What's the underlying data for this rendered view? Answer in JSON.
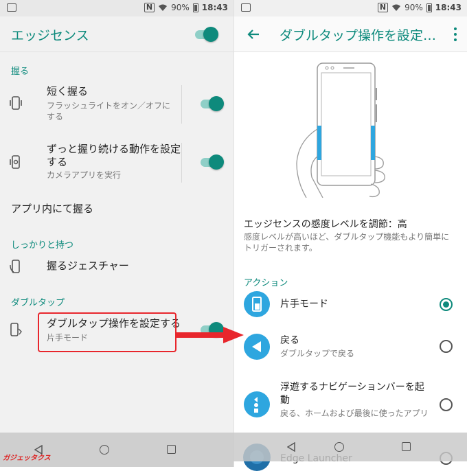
{
  "status_bar": {
    "battery": "90%",
    "time": "18:43",
    "nfc": "N"
  },
  "left": {
    "title": "エッジセンス",
    "master_toggle_on": true,
    "sections": [
      {
        "header": "握る"
      },
      {
        "header": "しっかりと持つ"
      },
      {
        "header": "ダブルタップ"
      }
    ],
    "items": {
      "short_squeeze": {
        "title": "短く握る",
        "subtitle": "フラッシュライトをオン／オフにする",
        "icon": "phone-squeeze-icon",
        "toggle_on": true
      },
      "long_squeeze": {
        "title": "ずっと握り続ける動作を設定する",
        "subtitle": "カメラアプリを実行",
        "icon": "phone-camera-icon",
        "toggle_on": true
      },
      "in_app_squeeze": {
        "title": "アプリ内にて握る"
      },
      "squeeze_gesture": {
        "title": "握るジェスチャー",
        "icon": "phone-hold-icon"
      },
      "double_tap": {
        "title": "ダブルタップ操作を設定する",
        "subtitle": "片手モード",
        "icon": "phone-doubletap-icon",
        "toggle_on": true
      }
    }
  },
  "right": {
    "title": "ダブルタップ操作を設定…",
    "sensitivity_title": "エッジセンスの感度レベルを調節：高",
    "sensitivity_desc": "感度レベルが高いほど、ダブルタップ機能もより簡単にトリガーされます。",
    "actions_header": "アクション",
    "actions": [
      {
        "title": "片手モード",
        "subtitle": "",
        "icon": "one-hand-mode-icon",
        "selected": true
      },
      {
        "title": "戻る",
        "subtitle": "ダブルタップで戻る",
        "icon": "back-triangle-icon",
        "selected": false
      },
      {
        "title": "浮遊するナビゲーションバーを起動",
        "subtitle": "戻る、ホームおよび最後に使ったアプリ",
        "icon": "floating-navbar-icon",
        "selected": false
      },
      {
        "title": "Edge Launcher",
        "subtitle": "",
        "icon": "edge-launcher-icon",
        "selected": false
      }
    ]
  },
  "watermark": "ガジェッタクス",
  "colors": {
    "accent": "#0d8a7c",
    "highlight_red": "#e8262c",
    "action_blue": "#2ea6df"
  }
}
